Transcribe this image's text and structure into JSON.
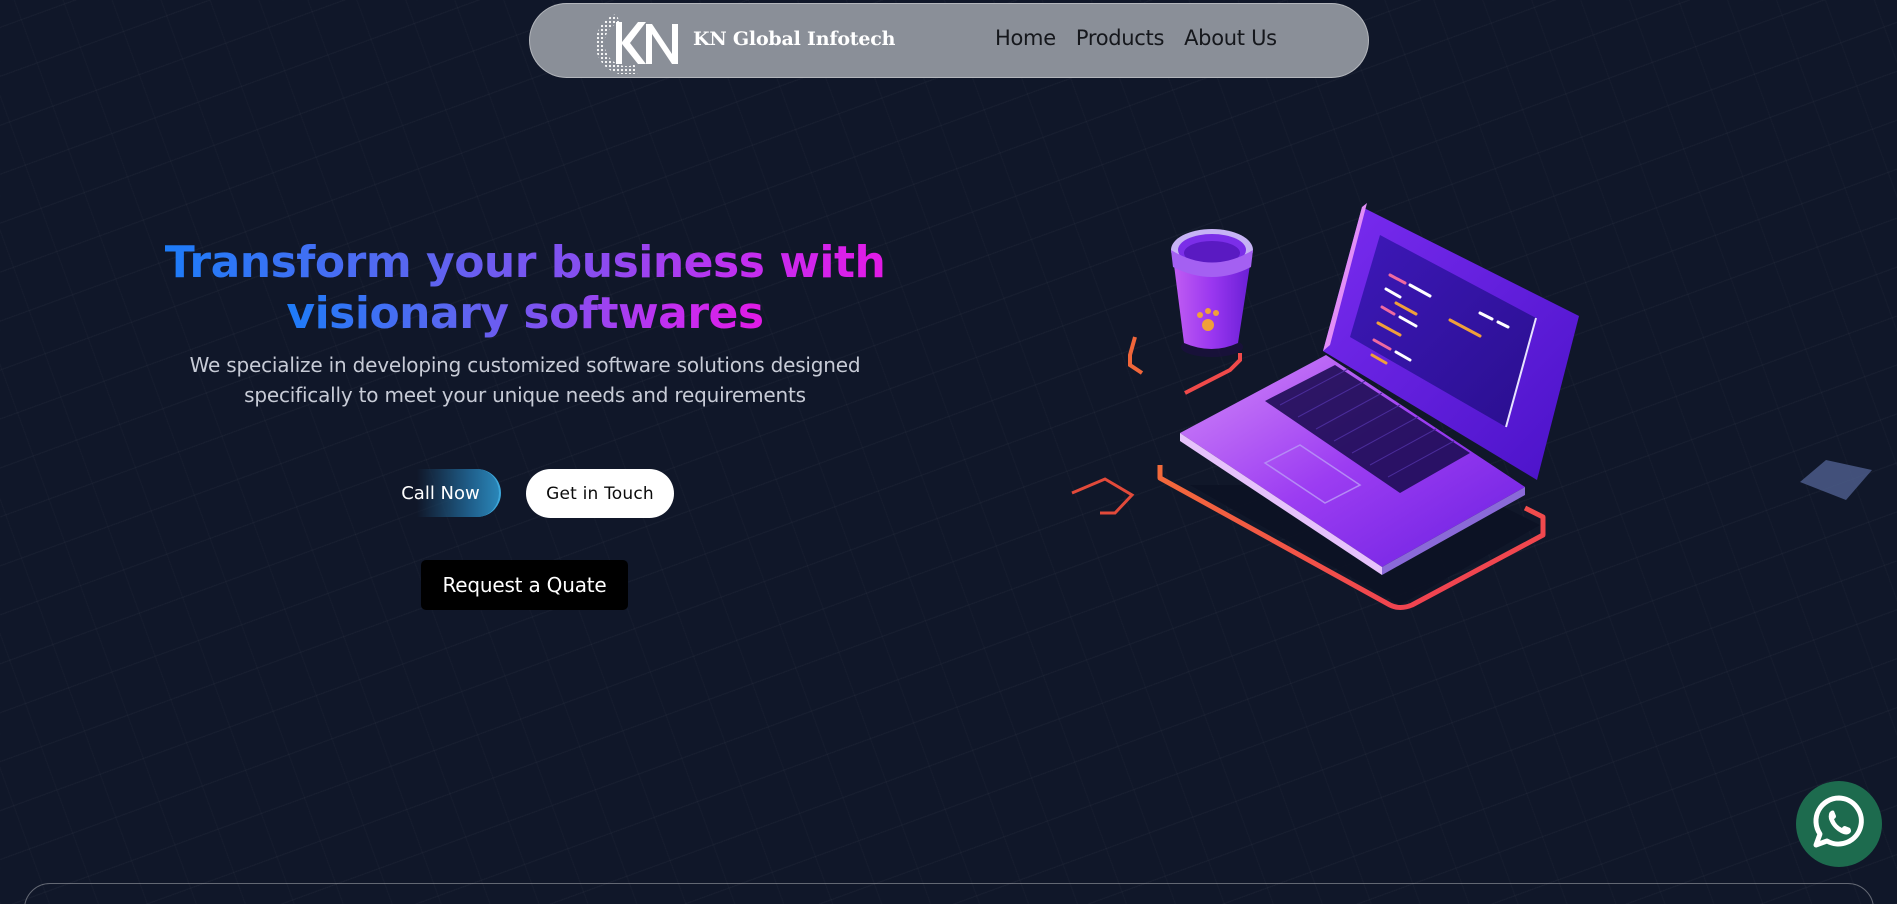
{
  "navbar": {
    "brand": "KN Global Infotech",
    "logo_text": "KN",
    "links": [
      {
        "label": "Home"
      },
      {
        "label": "Products"
      },
      {
        "label": "About Us"
      }
    ]
  },
  "hero": {
    "title_line1": "Transform your business with",
    "title_line2": "visionary softwares",
    "subtitle_line1": "We specialize in developing customized software solutions designed",
    "subtitle_line2": "specifically to meet your unique needs and requirements",
    "call_button": "Call Now",
    "touch_button": "Get in Touch",
    "quote_button": "Request a Quate"
  },
  "icons": {
    "whatsapp": "whatsapp-icon",
    "logo": "kn-logo-icon"
  },
  "colors": {
    "background": "#101729",
    "navbar": "#8a8f98",
    "gradient_start": "#1d7cf8",
    "gradient_end": "#e21ae6",
    "whatsapp": "#1d6b4e"
  }
}
